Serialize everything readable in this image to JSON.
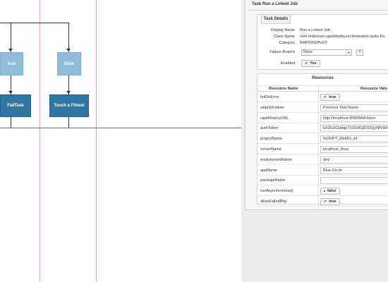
{
  "canvas": {
    "nodes": {
      "true_label": "true",
      "false_label": "false",
      "fail_task": "FailTask",
      "touch_fileset": "Touch a Fileset"
    },
    "colors": {
      "connector": "#24325a",
      "arrow": "#e8412d",
      "node_light": "#92bcd8",
      "node_dark": "#2f77a2",
      "guide": "#d9a3d9"
    }
  },
  "panel": {
    "title": "Task Run a Linked Job",
    "details": {
      "tab_label": "Task Details",
      "display_name_label": "Display Name",
      "display_name": "Run a Linked Job",
      "class_name_label": "Class Name",
      "class_name": "com.midvision.rapiddeploy.orchestration.tasks.Ru",
      "category_label": "Category",
      "category": "RAPIDDEPLOY",
      "failure_branch_label": "Failure Branch",
      "failure_branch": "None",
      "add_button": "+",
      "enabled_label": "Enabled",
      "enabled": "Yes"
    },
    "resources": {
      "title": "Resources",
      "col_name": "Resource Name",
      "col_value": "Resource Valu",
      "rows": [
        {
          "name": "failOnError",
          "value": "true",
          "kind": "toggle",
          "mark": "check"
        },
        {
          "name": "skipOnFailure",
          "value": "Previous Task Name",
          "kind": "input"
        },
        {
          "name": "rapidDeployURL",
          "value": "http://localhost:9090/MidVision",
          "kind": "input"
        },
        {
          "name": "authToken",
          "value": "bXZhZG1pbjp7X01WQEVOQyNfVdHI",
          "kind": "input"
        },
        {
          "name": "projectName",
          "value": "SCRIPT_DEMO_42",
          "kind": "input"
        },
        {
          "name": "serverName",
          "value": "localhost_linux",
          "kind": "input"
        },
        {
          "name": "environmentName",
          "value": "dev",
          "kind": "input"
        },
        {
          "name": "appName",
          "value": "Blue-Circle",
          "kind": "input"
        },
        {
          "name": "packageName",
          "value": "",
          "kind": "input"
        },
        {
          "name": "runAsynchronously",
          "value": "false",
          "kind": "toggle",
          "mark": "dot"
        },
        {
          "name": "allowFailedPkg",
          "value": "true",
          "kind": "toggle",
          "mark": "check"
        }
      ]
    }
  }
}
